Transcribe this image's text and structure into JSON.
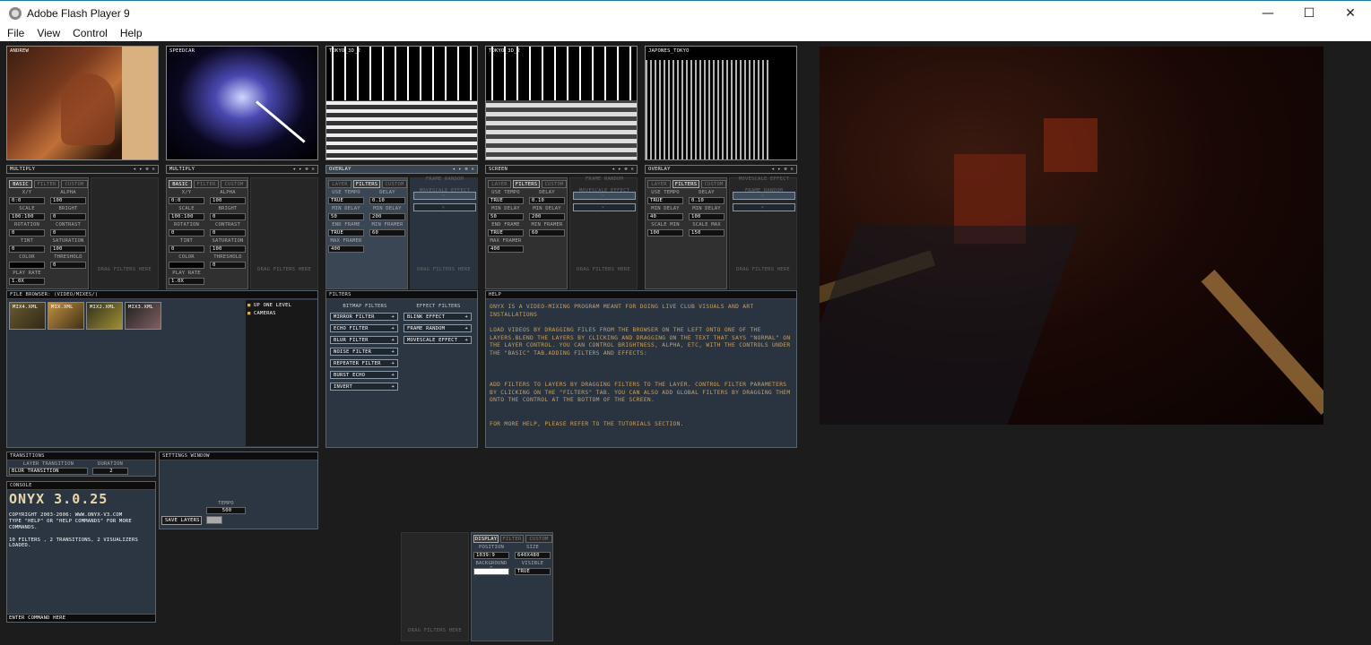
{
  "window": {
    "title": "Adobe Flash Player 9",
    "minimize": "—",
    "maximize": "☐",
    "close": "✕"
  },
  "menu": [
    "File",
    "View",
    "Control",
    "Help"
  ],
  "thumbs": [
    {
      "label": "ANDREW"
    },
    {
      "label": "SPEEDCAR"
    },
    {
      "label": "TOKYO_3D_2"
    },
    {
      "label": "TOKYO_3D_2"
    },
    {
      "label": "JAPONES_TOKYO"
    }
  ],
  "layers": [
    {
      "blend": "MULTIPLY",
      "tab": "BASIC"
    },
    {
      "blend": "MULTIPLY",
      "tab": "BASIC"
    },
    {
      "blend": "OVERLAY",
      "tab": "FILTERS"
    },
    {
      "blend": "SCREEN",
      "tab": "FILTERS"
    },
    {
      "blend": "OVERLAY",
      "tab": "FILTERS"
    }
  ],
  "layer_controls": "◂ ▸ ⊗ ✕",
  "tabs": {
    "basic": "BASIC",
    "filter": "FILTER",
    "custom": "CUSTOM",
    "layer": "LAYER",
    "filters": "FILTERS",
    "display": "DISPLAY"
  },
  "basic_params": [
    [
      "X/Y",
      "0:0",
      "ALPHA",
      "100"
    ],
    [
      "SCALE",
      "100:100",
      "BRIGHT",
      "0"
    ],
    [
      "ROTATION",
      "0",
      "CONTRAST",
      "0"
    ],
    [
      "TINT",
      "0",
      "SATURATION",
      "100"
    ],
    [
      "COLOR",
      "",
      "THRESHOLD",
      "0"
    ]
  ],
  "play_rate": {
    "label": "PLAY RATE",
    "value": "1.0X"
  },
  "drag_filters": "DRAG FILTERS HERE",
  "layer3": {
    "params": [
      [
        "USE TEMPO",
        "TRUE",
        "DELAY",
        "0.10"
      ],
      [
        "MIN DELAY",
        "50",
        "MIN DELAY",
        "200"
      ],
      [
        "END FRAME",
        "TRUE",
        "MIN FRAMER",
        "60"
      ],
      [
        "MAX FRAMER",
        "400",
        "",
        ""
      ]
    ],
    "filters": [
      "FRAME RANDOM",
      "MOVESCALE EFFECT"
    ]
  },
  "layer4": {
    "params": [
      [
        "USE TEMPO",
        "TRUE",
        "DELAY",
        "0.10"
      ],
      [
        "MIN DELAY",
        "50",
        "MIN DELAY",
        "200"
      ],
      [
        "END FRAME",
        "TRUE",
        "MIN FRAMER",
        "60"
      ],
      [
        "MAX FRAMER",
        "400",
        "",
        ""
      ]
    ],
    "filters": [
      "FRAME RANDOM",
      "MOVESCALE EFFECT"
    ]
  },
  "layer5": {
    "params": [
      [
        "USE TEMPO",
        "TRUE",
        "DELAY",
        "0.10"
      ],
      [
        "MIN DELAY",
        "40",
        "MIN DELAY",
        "100"
      ],
      [
        "SCALE MIN",
        "100",
        "SCALE MAX",
        "150"
      ]
    ],
    "filters": [
      "MOVESCALE EFFECT",
      "FRAME RANDOM"
    ]
  },
  "browser": {
    "title": "FILE BROWSER: (VIDEO/MIXES/)",
    "files": [
      "MIX4.XML",
      "MIX.XML",
      "MIX2.XML",
      "MIX3.XML"
    ],
    "dirs": [
      "UP ONE LEVEL",
      "CAMERAS"
    ]
  },
  "filters_panel": {
    "title": "FILTERS",
    "bitmap_title": "BITMAP FILTERS",
    "effect_title": "EFFECT FILTERS",
    "bitmap": [
      "MIRROR FILTER",
      "ECHO FILTER",
      "BLUR FILTER",
      "NOISE FILTER",
      "REPEATER FILTER",
      "BURST ECHO",
      "INVERT"
    ],
    "effect": [
      "BLINK EFFECT",
      "FRAME RANDOM",
      "MOVESCALE EFFECT"
    ],
    "add": "+"
  },
  "help": {
    "title": "HELP",
    "p1": "ONYX IS A VIDEO-MIXING PROGRAM MEANT FOR DOING LIVE CLUB VISUALS AND ART INSTALLATIONS",
    "p2": "LOAD VIDEOS BY DRAGGING FILES FROM THE BROWSER ON THE LEFT ONTO ONE OF THE LAYERS.BLEND THE LAYERS BY CLICKING AND DRAGGING ON THE TEXT THAT SAYS \"NORMAL\" ON THE LAYER CONTROL.  YOU CAN CONTROL BRIGHTNESS, ALPHA, ETC, WITH THE CONTROLS UNDER THE \"BASIC\" TAB.ADDING FILTERS AND EFFECTS:",
    "p3": "ADD FILTERS TO LAYERS BY DRAGGING FILTERS TO THE LAYER. CONTROL FILTER PARAMETERS BY CLICKING ON THE \"FILTERS\" TAB.  YOU CAN ALSO ADD GLOBAL FILTERS BY DRAGGING THEM ONTO THE CONTROL AT THE BOTTOM OF THE SCREEN.",
    "p4": "FOR MORE HELP, PLEASE REFER TO THE TUTORIALS SECTION."
  },
  "transitions": {
    "title": "TRANSITIONS",
    "layer_label": "LAYER TRANSITION",
    "layer_value": "BLUR TRANSITION",
    "duration_label": "DURATION",
    "duration_value": "2"
  },
  "settings": {
    "title": "SETTINGS WINDOW",
    "tempo_label": "TEMPO",
    "tempo_value": "500",
    "save": "SAVE LAYERS"
  },
  "console": {
    "title": "CONSOLE",
    "logo": "ONYX 3.0.25",
    "lines": [
      "COPYRIGHT 2003-2006: WWW.ONYX-V3.COM",
      "TYPE \"HELP\" OR \"HELP COMMANDS\" FOR MORE COMMANDS.",
      "10 FILTERS , 2 TRANSITIONS, 2 VISUALIZERS LOADED."
    ],
    "input_placeholder": "ENTER COMMAND HERE"
  },
  "display": {
    "position_label": "POSITION",
    "position_value": "1039:9",
    "size_label": "SIZE",
    "size_value": "640X480",
    "bg_label": "BACKGROUND C",
    "visible_label": "VISIBLE",
    "visible_value": "TRUE"
  }
}
